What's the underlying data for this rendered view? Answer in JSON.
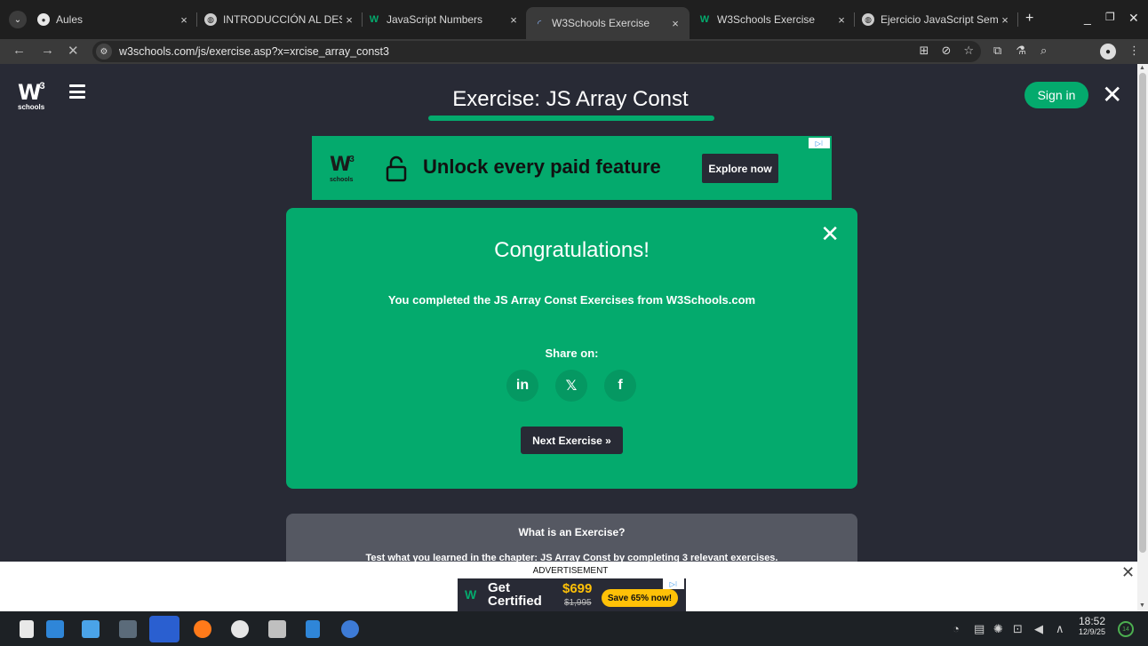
{
  "browser": {
    "tabs": [
      {
        "label": "Aules",
        "icon": "moodle-icon"
      },
      {
        "label": "INTRODUCCIÓN AL DESAR",
        "icon": "globe-icon"
      },
      {
        "label": "JavaScript Numbers",
        "icon": "w3schools-icon"
      },
      {
        "label": "W3Schools Exercise",
        "icon": "loading-icon",
        "active": true
      },
      {
        "label": "W3Schools Exercise",
        "icon": "w3schools-icon"
      },
      {
        "label": "Ejercicio JavaScript Seman",
        "icon": "globe-icon"
      }
    ],
    "url": "w3schools.com/js/exercise.asp?x=xrcise_array_const3"
  },
  "header": {
    "logo_main": "W",
    "logo_sup": "3",
    "logo_sub": "schools",
    "title": "Exercise: JS Array Const",
    "signin_label": "Sign in"
  },
  "ad_top": {
    "logo_main": "W",
    "logo_sup": "3",
    "logo_sub": "schools",
    "text": "Unlock every paid feature",
    "button": "Explore now"
  },
  "congrats": {
    "title": "Congratulations!",
    "message": "You completed the JS Array Const Exercises from W3Schools.com",
    "share_label": "Share on:",
    "share_buttons": [
      {
        "label": "in",
        "icon": "linkedin-icon"
      },
      {
        "label": "𝕏",
        "icon": "x-icon"
      },
      {
        "label": "f",
        "icon": "facebook-icon"
      }
    ],
    "next_label": "Next Exercise »"
  },
  "info": {
    "title": "What is an Exercise?",
    "text": "Test what you learned in the chapter: JS Array Const by completing 3 relevant exercises."
  },
  "ad_bottom": {
    "label": "ADVERTISEMENT",
    "logo": "W",
    "get": "Get",
    "certified": "Certified",
    "price": "$699",
    "old_price": "$1,995",
    "save": "Save 65% now!"
  },
  "taskbar": {
    "time": "18:52",
    "date": "12/9/25",
    "notif": "14"
  },
  "colors": {
    "w3_green": "#04AA6D",
    "w3_dark": "#282A35",
    "accent_yellow": "#FFC107"
  }
}
